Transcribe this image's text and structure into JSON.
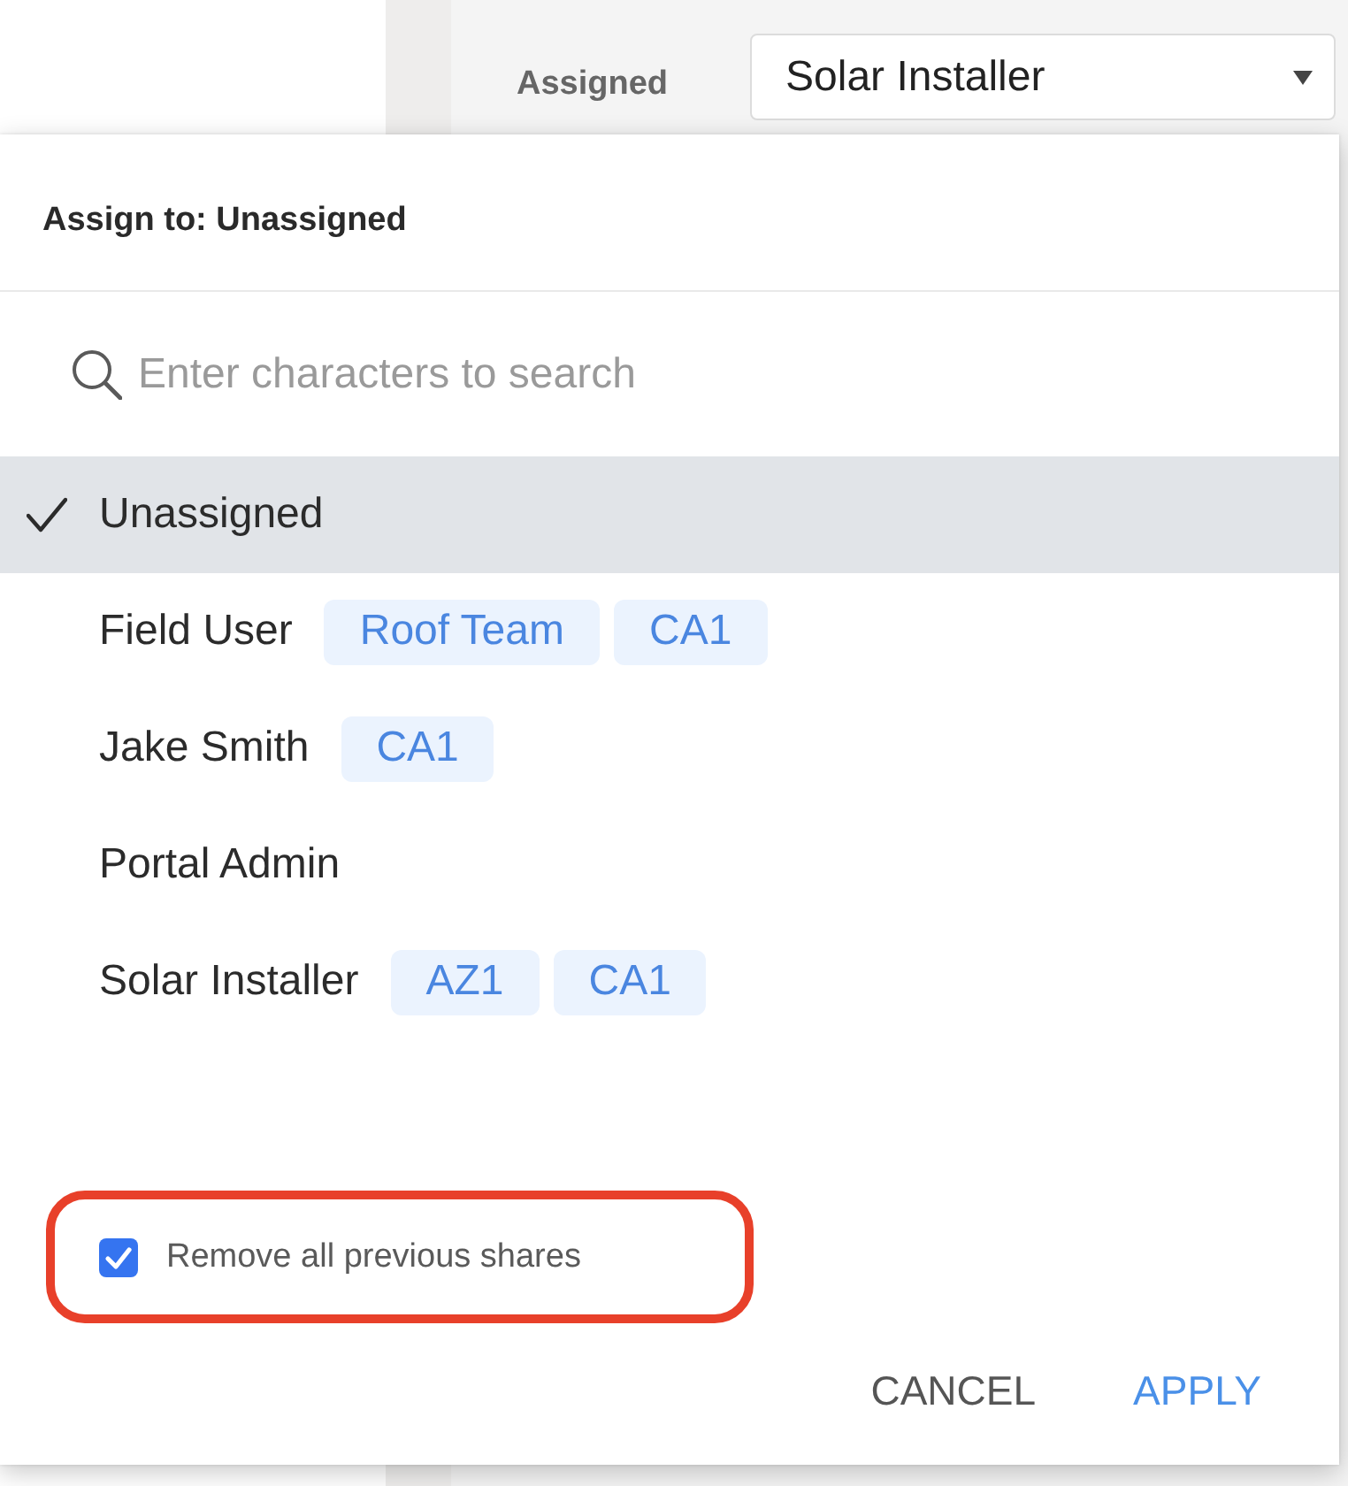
{
  "background_form": {
    "label": "Assigned",
    "value": "Solar Installer"
  },
  "dialog": {
    "title": "Assign to: Unassigned",
    "search": {
      "placeholder": "Enter characters to search"
    },
    "options": [
      {
        "name": "Unassigned",
        "selected": true
      },
      {
        "name": "Field User",
        "selected": false,
        "tags": [
          "Roof Team",
          "CA1"
        ]
      },
      {
        "name": "Jake Smith",
        "selected": false,
        "tags": [
          "CA1"
        ]
      },
      {
        "name": "Portal Admin",
        "selected": false
      },
      {
        "name": "Solar Installer",
        "selected": false,
        "tags": [
          "AZ1",
          "CA1"
        ]
      }
    ],
    "remove_previous_shares": {
      "label": "Remove all previous shares",
      "checked": true,
      "highlighted": true
    },
    "buttons": [
      {
        "label": "CANCEL",
        "kind": "secondary"
      },
      {
        "label": "APPLY",
        "kind": "primary"
      }
    ]
  }
}
